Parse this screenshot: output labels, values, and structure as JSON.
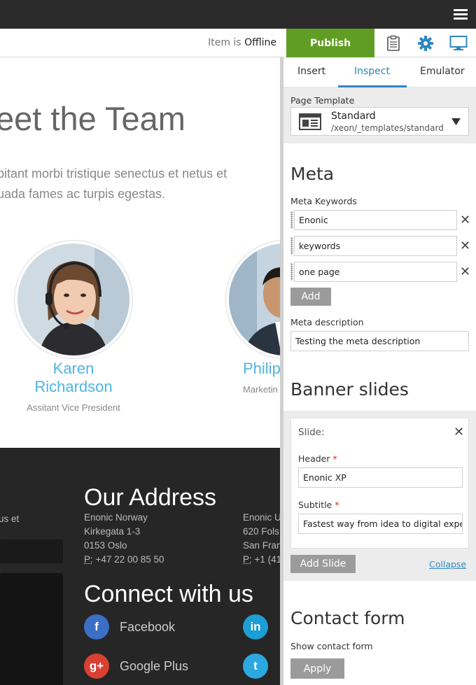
{
  "toolbar": {
    "status_prefix": "Item is",
    "status_value": "Offline",
    "publish_label": "Publish",
    "icons": [
      "clipboard-icon",
      "gear-icon",
      "monitor-icon"
    ]
  },
  "preview": {
    "team_title": "eet the Team",
    "team_text": "bitant morbi tristique senectus et netus et\nuada fames ac turpis egestas.",
    "members": [
      {
        "name": "Karen\nRichardson",
        "role": "Assitant Vice President"
      },
      {
        "name": "Philip",
        "role": "Marketin"
      }
    ],
    "footer": {
      "left_fragment": "us et",
      "address_title": "Our Address",
      "address_lines": "Enonic Norway\nKirkegata 1-3\n0153 Oslo",
      "phone_prefix": "P:",
      "phone": "+47 22 00 85 50",
      "address2_lines": "Enonic U\n620 Fols\nSan Fran",
      "phone2_prefix": "P:",
      "phone2": "+1 (41",
      "connect_title": "Connect with us",
      "social": [
        {
          "icon": "f",
          "label": "Facebook",
          "color": "#3b6fc6"
        },
        {
          "icon": "g+",
          "label": "Google Plus",
          "color": "#d94032"
        },
        {
          "icon": "in",
          "label": "",
          "color": "#1c9ed6"
        },
        {
          "icon": "t",
          "label": "",
          "color": "#2ba8e0"
        }
      ]
    }
  },
  "panel": {
    "tabs": [
      {
        "label": "Insert"
      },
      {
        "label": "Inspect",
        "active": true
      },
      {
        "label": "Emulator"
      }
    ],
    "page_template_label": "Page Template",
    "template": {
      "name": "Standard",
      "path": "/xeon/_templates/standard"
    },
    "meta_title": "Meta",
    "meta_keywords_label": "Meta Keywords",
    "keywords": [
      "Enonic",
      "keywords",
      "one page"
    ],
    "add_label": "Add",
    "meta_description_label": "Meta description",
    "meta_description_value": "Testing the meta description",
    "banner_title": "Banner slides",
    "slide_label": "Slide:",
    "header_label": "Header",
    "header_value": "Enonic XP",
    "subtitle_label": "Subtitle",
    "subtitle_value": "Fastest way from idea to digital experien",
    "required_mark": "*",
    "add_slide_label": "Add Slide",
    "collapse_label": "Collapse",
    "contact_title": "Contact form",
    "show_contact_label": "Show contact form",
    "apply_label": "Apply",
    "accent_color": "#2e86c1"
  }
}
